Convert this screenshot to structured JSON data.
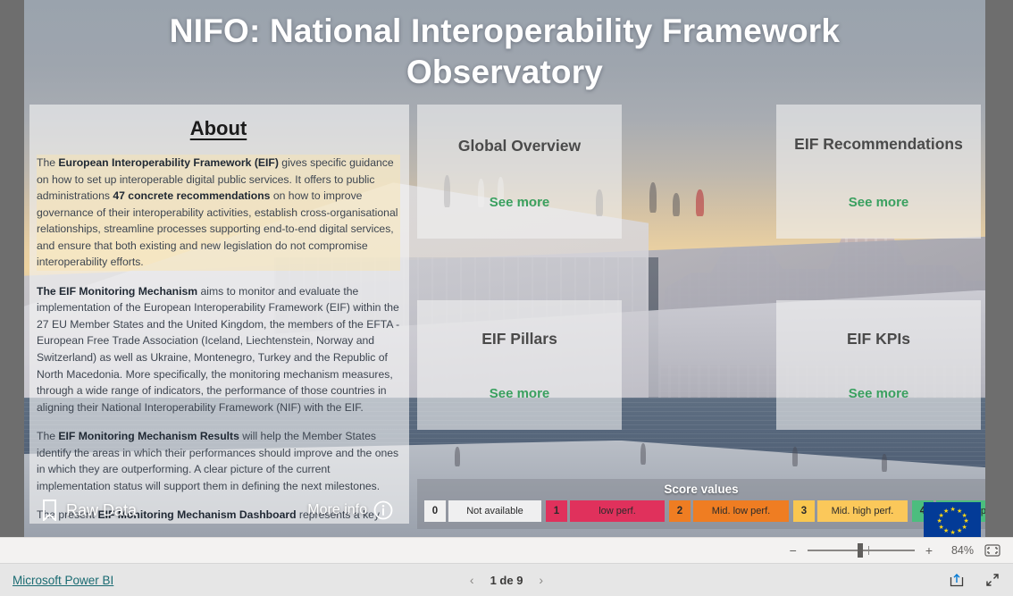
{
  "report": {
    "title": "NIFO: National Interoperability Framework Observatory"
  },
  "about": {
    "heading": "About",
    "paragraphs": [
      {
        "highlight": true,
        "runs": [
          {
            "t": "The ",
            "b": false
          },
          {
            "t": "European Interoperability Framework (EIF)",
            "b": true
          },
          {
            "t": " gives specific guidance on how to set up interoperable digital public services. It offers to public administrations ",
            "b": false
          },
          {
            "t": "47 concrete recommendations",
            "b": true
          },
          {
            "t": " on how to improve governance of their interoperability activities, establish cross-organisational relationships, streamline processes supporting end-to-end digital services, and ensure that both existing and new legislation do not compromise interoperability efforts.",
            "b": false
          }
        ]
      },
      {
        "highlight": false,
        "runs": [
          {
            "t": "The EIF Monitoring Mechanism",
            "b": true
          },
          {
            "t": " aims to monitor and evaluate the implementation of the European Interoperability Framework (EIF) within the 27 EU Member States and the United Kingdom, the members of the EFTA - European Free Trade Association (Iceland, Liechtenstein, Norway and Switzerland) as well as Ukraine, Montenegro, Turkey and the Republic of North Macedonia. More specifically, the monitoring mechanism measures, through a wide range of indicators, the performance of those countries in aligning their National Interoperability Framework (NIF) with the EIF.",
            "b": false
          }
        ]
      },
      {
        "highlight": false,
        "runs": [
          {
            "t": "The ",
            "b": false
          },
          {
            "t": "EIF Monitoring Mechanism Results",
            "b": true
          },
          {
            "t": " will help the Member States identify the areas in which their performances should improve and the ones in which they are outperforming. A clear picture of the current implementation status will support them in defining the next milestones.",
            "b": false
          }
        ]
      },
      {
        "highlight": false,
        "runs": [
          {
            "t": "The present ",
            "b": false
          },
          {
            "t": "EIF Monitoring Mechanism Dashboard",
            "b": true
          },
          {
            "t": " represents a key tool that provides stakeholders with a clear overview of the status and level of implementation of the EIF within each concerned country. The interactive dashboard showcases the performance of the countries at different levels of granularity: EIF Pillars, Key Performance Indicators (KPIs) and EIF",
            "b": false
          }
        ]
      }
    ],
    "raw_data_label": "Raw Data",
    "more_info_label": "More info"
  },
  "tiles": [
    {
      "id": "global",
      "title": "Global Overview",
      "link": "See more"
    },
    {
      "id": "reco",
      "title": "EIF Recommendations",
      "link": "See more"
    },
    {
      "id": "pillars",
      "title": "EIF Pillars",
      "link": "See more"
    },
    {
      "id": "kpis",
      "title": "EIF KPIs",
      "link": "See more"
    }
  ],
  "legend": {
    "title": "Score values",
    "items": [
      {
        "score": "0",
        "label": "Not available",
        "num_bg": "#f0f0f0",
        "bar_bg": "#efeff0",
        "text": "#2b2b2b"
      },
      {
        "score": "1",
        "label": "low perf.",
        "num_bg": "#e0315c",
        "bar_bg": "#e0315c",
        "text": "#2b2b2b"
      },
      {
        "score": "2",
        "label": "Mid. low perf.",
        "num_bg": "#ef7d22",
        "bar_bg": "#ef7d22",
        "text": "#2b2b2b"
      },
      {
        "score": "3",
        "label": "Mid. high perf.",
        "num_bg": "#f9c74f",
        "bar_bg": "#fbc85a",
        "text": "#2b2b2b"
      },
      {
        "score": "4",
        "label": "High perf.",
        "num_bg": "#4cbd7e",
        "bar_bg": "#4cbd7e",
        "text": "#2b2b2b"
      }
    ]
  },
  "zoombar": {
    "minus": "−",
    "plus": "+",
    "percent": "84%",
    "fit_icon": "fit-to-page-icon"
  },
  "footer": {
    "brand": "Microsoft Power BI",
    "prev_icon": "chevron-left-icon",
    "next_icon": "chevron-right-icon",
    "page_label": "1 de 9",
    "share_icon": "share-icon",
    "fullscreen_icon": "fullscreen-icon"
  },
  "colors": {
    "accent_link": "#3aa060",
    "brand_link": "#1a6b72",
    "eu_blue": "#033b97",
    "eu_yellow": "#f7d417"
  }
}
